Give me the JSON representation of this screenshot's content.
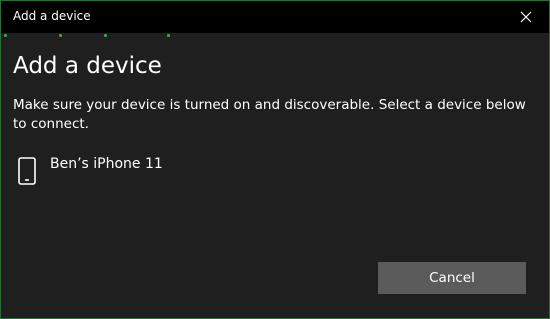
{
  "window": {
    "title": "Add a device",
    "close_icon": "close-icon"
  },
  "heading": "Add a device",
  "description": "Make sure your device is turned on and discoverable. Select a device below to connect.",
  "devices": [
    {
      "name": "Ben’s iPhone 11",
      "icon": "phone-icon"
    }
  ],
  "actions": {
    "cancel_label": "Cancel"
  },
  "colors": {
    "titlebar": "#000000",
    "background": "#1f1f1f",
    "accent_green": "#3aa447",
    "button": "#5b5b5b",
    "text": "#ffffff"
  }
}
